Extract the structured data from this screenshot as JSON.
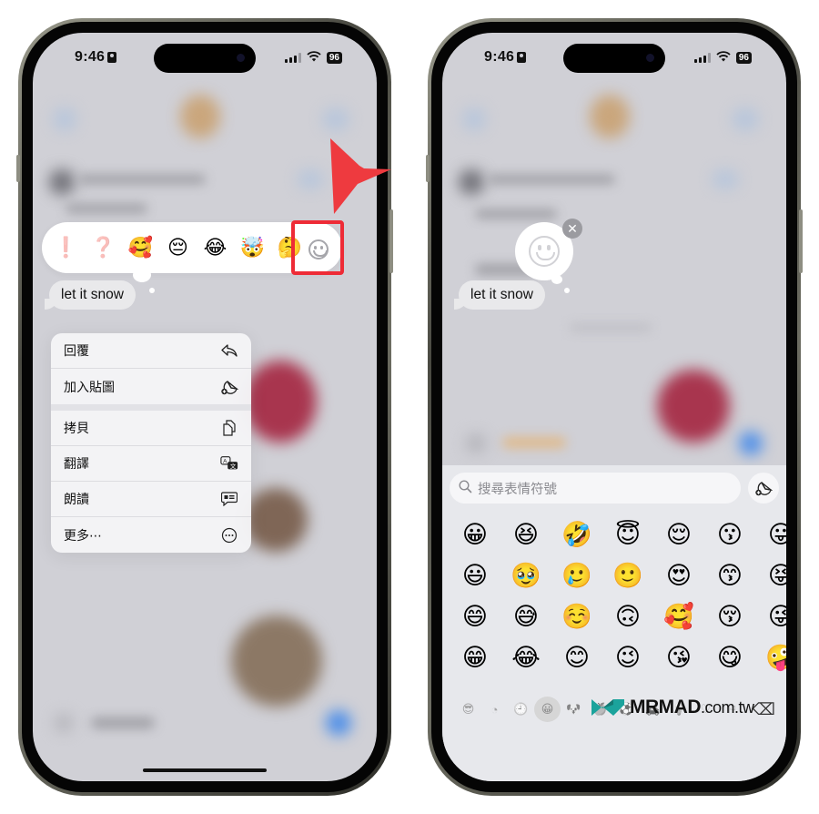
{
  "status_bar": {
    "time": "9:46",
    "battery": "96"
  },
  "left_phone": {
    "reactions": [
      "❗",
      "❓",
      "🥰",
      "😔",
      "😂",
      "🤯",
      "🤔"
    ],
    "add_emoji_reaction_icon": "smiley-outline-icon",
    "highlight_color": "#EE2B36",
    "message_text": "let it snow",
    "context_menu": [
      {
        "label": "回覆",
        "icon": "reply-icon"
      },
      {
        "label": "加入貼圖",
        "icon": "add-sticker-icon"
      },
      {
        "label": "拷貝",
        "icon": "copy-icon"
      },
      {
        "label": "翻譯",
        "icon": "translate-icon"
      },
      {
        "label": "朗讀",
        "icon": "speak-icon"
      },
      {
        "label": "更多⋯",
        "icon": "more-icon"
      }
    ]
  },
  "right_phone": {
    "message_text": "let it snow",
    "pending_reaction_icon": "smiley-outline-icon",
    "close_label": "✕",
    "keyboard": {
      "search_placeholder": "搜尋表情符號",
      "emoji_rows": [
        [
          "😀",
          "😆",
          "🤣",
          "😇",
          "😌",
          "😗",
          "😛"
        ],
        [
          "😃",
          "🥹",
          "🥲",
          "🙂",
          "😍",
          "😙",
          "😝"
        ],
        [
          "😄",
          "😅",
          "☺️",
          "🙃",
          "🥰",
          "😚",
          "😜"
        ],
        [
          "😁",
          "😂",
          "😊",
          "😉",
          "😘",
          "😋",
          "🤪"
        ]
      ],
      "categories": [
        {
          "name": "memoji",
          "glyph": "😎"
        },
        {
          "name": "stickers",
          "glyph": "◔"
        },
        {
          "name": "recent",
          "glyph": "🕘"
        },
        {
          "name": "smileys",
          "glyph": "😀",
          "active": true
        },
        {
          "name": "animals",
          "glyph": "🐶"
        },
        {
          "name": "food",
          "glyph": "🍏"
        },
        {
          "name": "activity",
          "glyph": "⚽"
        },
        {
          "name": "travel",
          "glyph": "🚗"
        },
        {
          "name": "objects",
          "glyph": "💡"
        },
        {
          "name": "symbols",
          "glyph": "♡"
        },
        {
          "name": "flags",
          "glyph": "⚐"
        }
      ],
      "delete_glyph": "⌫"
    }
  },
  "watermark": {
    "brand": "MRMAD",
    "domain": ".com.tw",
    "color": "#1BA39C"
  }
}
